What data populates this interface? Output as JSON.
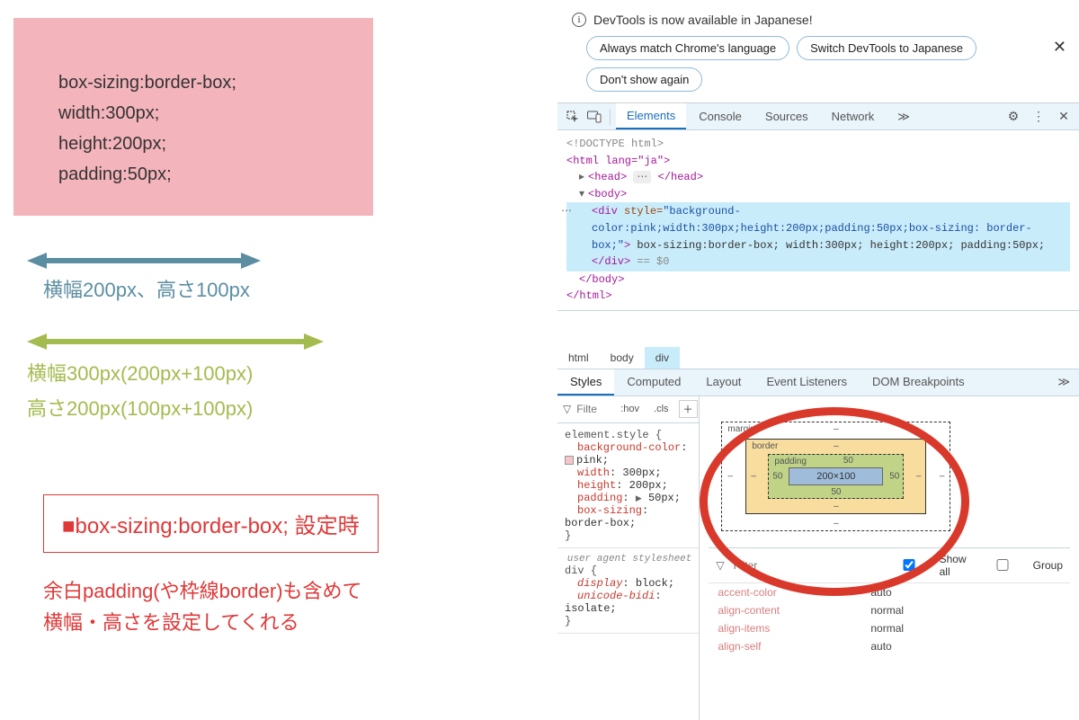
{
  "left": {
    "pink_lines": [
      "box-sizing:border-box;",
      "width:300px;",
      "height:200px;",
      "padding:50px;"
    ],
    "blue_caption": "横幅200px、高さ100px",
    "green_line1": "横幅300px(200px+100px)",
    "green_line2": "高さ200px(100px+100px)",
    "redframe": "■box-sizing:border-box; 設定時",
    "reddesc1": "余白padding(や枠線border)も含めて",
    "reddesc2": "横幅・高さを設定してくれる"
  },
  "devtools": {
    "banner": {
      "title": "DevTools is now available in Japanese!",
      "btn1": "Always match Chrome's language",
      "btn2": "Switch DevTools to Japanese",
      "btn3": "Don't show again"
    },
    "tabs": {
      "elements": "Elements",
      "console": "Console",
      "sources": "Sources",
      "network": "Network",
      "more": "≫"
    },
    "dom": {
      "doctype": "<!DOCTYPE html>",
      "html_open": "<html lang=\"ja\">",
      "head": "<head> ⋯ </head>",
      "body_open": "<body>",
      "div_open_a": "<div style=",
      "div_style": "\"background-color:pink;width:300px;height:200px;padding:50px;box-sizing: border-box;\"",
      "div_open_b": ">",
      "div_text": " box-sizing:border-box; width:300px; height:200px; padding:50px; ",
      "div_close": "</div>",
      "eq0": " == $0",
      "body_close": "</body>",
      "html_close": "</html>"
    },
    "crumbs": {
      "c1": "html",
      "c2": "body",
      "c3": "div"
    },
    "subtabs": {
      "styles": "Styles",
      "computed": "Computed",
      "layout": "Layout",
      "events": "Event Listeners",
      "dombp": "DOM Breakpoints",
      "more": "≫"
    },
    "filterbar": {
      "placeholder": "Filte",
      "hov": ":hov",
      "cls": ".cls"
    },
    "rule1": {
      "selector": "element.style {",
      "p1": "background-color",
      "v1": "pink;",
      "p2": "width",
      "v2": "300px;",
      "p3": "height",
      "v3": "200px;",
      "p4": "padding",
      "v4": "50px;",
      "p5": "box-sizing",
      "v5": "border-box;",
      "close": "}"
    },
    "rule2": {
      "selector": "div {",
      "ua": "user agent stylesheet",
      "p1": "display",
      "v1": "block;",
      "p2": "unicode-bidi",
      "v2": "isolate;",
      "close": "}"
    },
    "boxmodel": {
      "margin_label": "margin",
      "border_label": "border",
      "padding_label": "padding",
      "pad_top": "50",
      "pad_right": "50",
      "pad_bottom": "50",
      "pad_left": "50",
      "content": "200×100",
      "dash": "–"
    },
    "computed_filter": {
      "placeholder": "Filter",
      "showall": "Show all",
      "group": "Group"
    },
    "computed": [
      {
        "name": "accent-color",
        "val": "auto"
      },
      {
        "name": "align-content",
        "val": "normal"
      },
      {
        "name": "align-items",
        "val": "normal"
      },
      {
        "name": "align-self",
        "val": "auto"
      }
    ]
  }
}
